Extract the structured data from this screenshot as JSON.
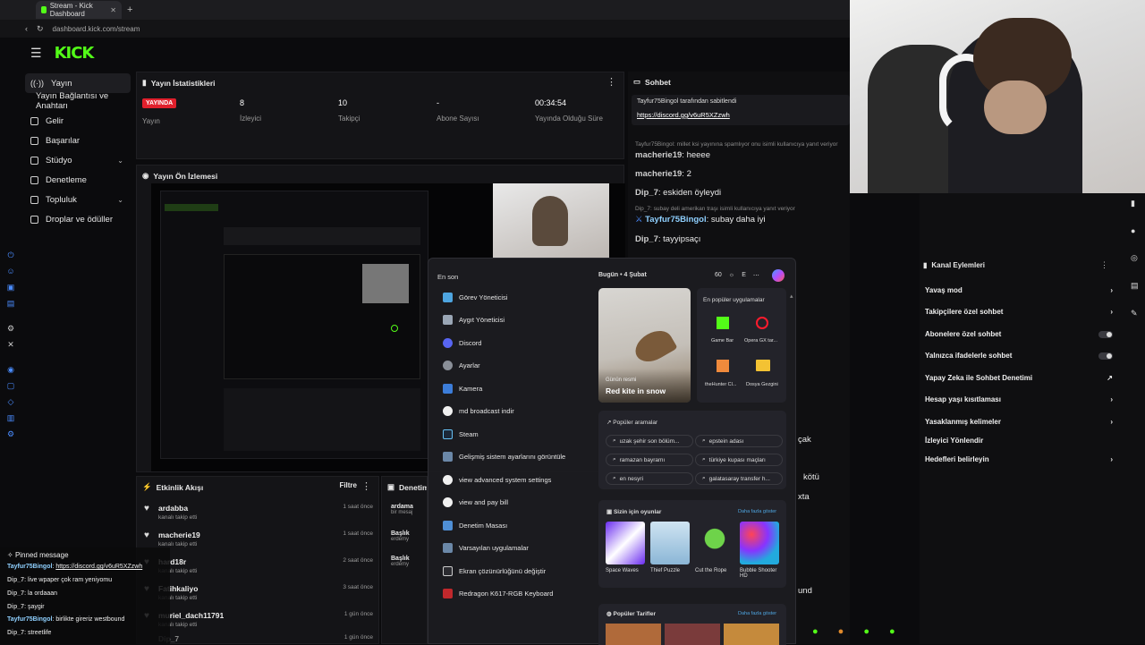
{
  "browser": {
    "tab_title": "Stream - Kick Dashboard",
    "url": "dashboard.kick.com/stream"
  },
  "header": {
    "logo": "KICK"
  },
  "sidebar": {
    "items": [
      {
        "label": "Yayın"
      },
      {
        "label": "Yayın Bağlantısı ve Anahtarı"
      },
      {
        "label": "Gelir"
      },
      {
        "label": "Başarılar"
      },
      {
        "label": "Stüdyo"
      },
      {
        "label": "Denetleme"
      },
      {
        "label": "Topluluk"
      },
      {
        "label": "Droplar ve ödüller"
      }
    ]
  },
  "stats": {
    "title": "Yayın İstatistikleri",
    "live_badge": "YAYINDA",
    "live_label": "Yayın",
    "viewers_value": "8",
    "viewers_label": "İzleyici",
    "followers_value": "10",
    "followers_label": "Takipçi",
    "subs_value": "-",
    "subs_label": "Abone Sayısı",
    "duration_value": "00:34:54",
    "duration_label": "Yayında Olduğu Süre"
  },
  "preview": {
    "title": "Yayın Ön İzlemesi"
  },
  "activity": {
    "title": "Etkinlik Akışı",
    "filter": "Filtre",
    "rows": [
      {
        "name": "ardabba",
        "sub": "kanalı takip etti",
        "time": "1 saat önce"
      },
      {
        "name": "macherie19",
        "sub": "kanalı takip etti",
        "time": "1 saat önce"
      },
      {
        "name": "hard18r",
        "sub": "kanalı takip etti",
        "time": "2 saat önce"
      },
      {
        "name": "Fatihkaliyo",
        "sub": "kanalı takip etti",
        "time": "3 saat önce"
      },
      {
        "name": "muriel_dach11791",
        "sub": "kanalı takip etti",
        "time": "1 gün önce"
      },
      {
        "name": "Dip_7",
        "sub": "",
        "time": "1 gün önce"
      }
    ]
  },
  "moderation": {
    "title": "Denetim E",
    "rows": [
      {
        "name": "ardama",
        "sub": "bir mesaj"
      },
      {
        "name": "Başlık",
        "sub": "erdemy"
      },
      {
        "name": "Başlık",
        "sub": "erdemy"
      }
    ]
  },
  "chat": {
    "title": "Sohbet",
    "pinned_by": "Tayfur75Bingol tarafından sabitlendi",
    "pinned_link": "https://discord.gg/v6uR5XZzwh",
    "lines": [
      {
        "user": "macherie19",
        "text": "heeee"
      },
      {
        "user": "macherie19",
        "text": "2"
      },
      {
        "user": "Dip_7",
        "text": "eskiden öyleydi"
      },
      {
        "user": "Tayfur75Bingol",
        "text": "subay daha iyi"
      },
      {
        "user": "Dip_7",
        "text": "tayyipsaçı"
      }
    ],
    "reply_note_1": "Tayfur75Bingol: millet ksi yayınına spamlıyor onu isimli kullanıcıya yanıt veriyor",
    "reply_note_2": "Dip_7: subay deli amerikan traşı isimli kullanıcıya yanıt veriyor",
    "fragments": [
      "çak",
      "kötü",
      "xta",
      "und"
    ]
  },
  "channel_actions": {
    "title": "Kanal Eylemleri",
    "rows": [
      {
        "label": "Yavaş mod"
      },
      {
        "label": "Takipçilere özel sohbet"
      },
      {
        "label": "Abonelere özel sohbet"
      },
      {
        "label": "Yalnızca ifadelerle sohbet"
      },
      {
        "label": "Yapay Zeka ile Sohbet Denetimi"
      },
      {
        "label": "Hesap yaşı kısıtlaması"
      },
      {
        "label": "Yasaklanmış kelimeler"
      },
      {
        "label": "İzleyici Yönlendir"
      },
      {
        "label": "Hedefleri belirleyin"
      }
    ]
  },
  "start_menu": {
    "recent_title": "En son",
    "apps": [
      "Görev Yöneticisi",
      "Aygıt Yöneticisi",
      "Discord",
      "Ayarlar",
      "Kamera",
      "md broadcast indir",
      "Steam",
      "Gelişmiş sistem ayarlarını görüntüle",
      "view advanced system settings",
      "view and pay bill",
      "Denetim Masası",
      "Varsayılan uygulamalar",
      "Ekran çözünürlüğünü değiştir",
      "Redragon K617-RGB Keyboard"
    ],
    "date": "Bugün • 4 Şubat",
    "temp": "60",
    "letter": "E",
    "picture_caption": "Günün resmi",
    "picture_title": "Red kite in snow",
    "popular_apps_title": "En popüler uygulamalar",
    "popular_apps": [
      "Game Bar",
      "Opera GX tar...",
      "theHunter Cl...",
      "Dosya Gezgini"
    ],
    "searches_title": "Popüler aramalar",
    "searches": [
      "uzak şehir son bölüm...",
      "epstein adası",
      "ramazan bayramı",
      "türkiye kupası maçları",
      "en nesyri",
      "galatasaray transfer h..."
    ],
    "games_title": "Sizin için oyunlar",
    "games_more": "Daha fazla göster",
    "games": [
      "Space Waves",
      "Thief Puzzle",
      "Cut the Rope",
      "Bubble Shooter HD"
    ],
    "recipes_title": "Popüler Tarifler",
    "recipes_more": "Daha fazla göster"
  },
  "pinned_overlay": {
    "title": "Pinned message",
    "lines": [
      {
        "user": "Tayfur75Bingol",
        "text": "https://discord.gg/v6uR5XZzwh"
      },
      {
        "user": "Dip_7",
        "text": "live wpaper çok ram yeniyomu"
      },
      {
        "user": "Dip_7",
        "text": "la ordaaan"
      },
      {
        "user": "Dip_7",
        "text": "şaygir"
      },
      {
        "user": "Tayfur75Bingol",
        "text": "birlikte gireriz westbound"
      },
      {
        "user": "Dip_7",
        "text": "streetlife"
      }
    ]
  },
  "colors": {
    "brand": "#53fc18",
    "live": "#e0202c",
    "bg": "#0b0b0d",
    "panel": "#141417"
  }
}
